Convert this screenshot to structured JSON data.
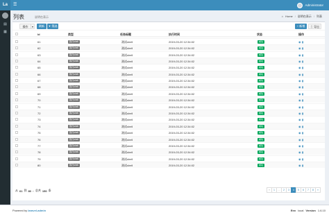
{
  "app": {
    "logo": "La",
    "toggle_icon": "menu-icon"
  },
  "user": {
    "name": "Administrator"
  },
  "sidebar": {
    "icons": [
      "user-icon",
      "grid-icon"
    ]
  },
  "header": {
    "title": "列表",
    "subtitle": "说明在表示",
    "breadcrumb": [
      "Home",
      "说明在表示",
      "列表"
    ]
  },
  "toolbar": {
    "ops": "操作",
    "refresh": "刷新",
    "filter": "筛选",
    "new": "新增",
    "export": "导出"
  },
  "table": {
    "columns": [
      "Id",
      "类型",
      "任务标题",
      "执行时间",
      "状态",
      "操作"
    ],
    "rows": [
      {
        "id": "61",
        "type": "执行shell",
        "title": "测试shell",
        "time": "2019-03-20 12:34:02",
        "status": "成功"
      },
      {
        "id": "62",
        "type": "执行shell",
        "title": "测试shell",
        "time": "2019-03-20 12:34:02",
        "status": "成功"
      },
      {
        "id": "63",
        "type": "执行shell",
        "title": "测试shell",
        "time": "2019-03-20 12:34:02",
        "status": "成功"
      },
      {
        "id": "64",
        "type": "执行shell",
        "title": "测试shell",
        "time": "2019-03-20 12:34:02",
        "status": "成功"
      },
      {
        "id": "65",
        "type": "执行shell",
        "title": "测试shell",
        "time": "2019-03-20 12:34:02",
        "status": "成功"
      },
      {
        "id": "66",
        "type": "执行shell",
        "title": "测试shell",
        "time": "2019-03-20 12:34:02",
        "status": "成功"
      },
      {
        "id": "67",
        "type": "执行shell",
        "title": "测试shell",
        "time": "2019-03-20 12:34:02",
        "status": "成功"
      },
      {
        "id": "68",
        "type": "执行shell",
        "title": "测试shell",
        "time": "2019-03-20 12:34:02",
        "status": "成功"
      },
      {
        "id": "69",
        "type": "执行shell",
        "title": "测试shell",
        "time": "2019-03-20 12:34:02",
        "status": "成功"
      },
      {
        "id": "70",
        "type": "执行shell",
        "title": "测试shell",
        "time": "2019-03-20 12:34:02",
        "status": "成功"
      },
      {
        "id": "71",
        "type": "执行shell",
        "title": "测试shell",
        "time": "2019-03-20 12:34:02",
        "status": "成功"
      },
      {
        "id": "72",
        "type": "执行shell",
        "title": "测试shell",
        "time": "2019-03-20 12:34:02",
        "status": "成功"
      },
      {
        "id": "73",
        "type": "执行shell",
        "title": "测试shell",
        "time": "2019-03-20 12:34:02",
        "status": "成功"
      },
      {
        "id": "74",
        "type": "执行shell",
        "title": "测试shell",
        "time": "2019-03-20 12:34:02",
        "status": "成功"
      },
      {
        "id": "75",
        "type": "执行shell",
        "title": "测试shell",
        "time": "2019-03-20 12:34:02",
        "status": "成功"
      },
      {
        "id": "76",
        "type": "执行shell",
        "title": "测试shell",
        "time": "2019-03-20 12:34:02",
        "status": "成功"
      },
      {
        "id": "77",
        "type": "执行shell",
        "title": "测试shell",
        "time": "2019-03-20 12:34:02",
        "status": "成功"
      },
      {
        "id": "78",
        "type": "执行shell",
        "title": "测试shell",
        "time": "2019-03-20 12:34:02",
        "status": "成功"
      },
      {
        "id": "79",
        "type": "执行shell",
        "title": "测试shell",
        "time": "2019-03-20 12:34:02",
        "status": "成功"
      },
      {
        "id": "80",
        "type": "执行shell",
        "title": "测试shell",
        "time": "2019-03-20 12:34:02",
        "status": "成功"
      }
    ]
  },
  "pagination": {
    "info_prefix": "从",
    "from": "61",
    "info_to": "到",
    "to": "80",
    "info_total": "，总共",
    "total": "150",
    "info_suffix": "条",
    "pages": [
      "«",
      "1",
      "...",
      "2",
      "3",
      "4",
      "5",
      "6",
      "7",
      "8",
      "»"
    ],
    "active_page": "4"
  },
  "footer": {
    "powered_prefix": "Powered by",
    "powered_link": "laravel-admin",
    "env_label": "Env",
    "env_value": "local",
    "version_label": "Version",
    "version_value": "1.6.10"
  },
  "colors": {
    "header": "#3c8dbc",
    "sidebar": "#222d32",
    "success": "#00a65a"
  }
}
